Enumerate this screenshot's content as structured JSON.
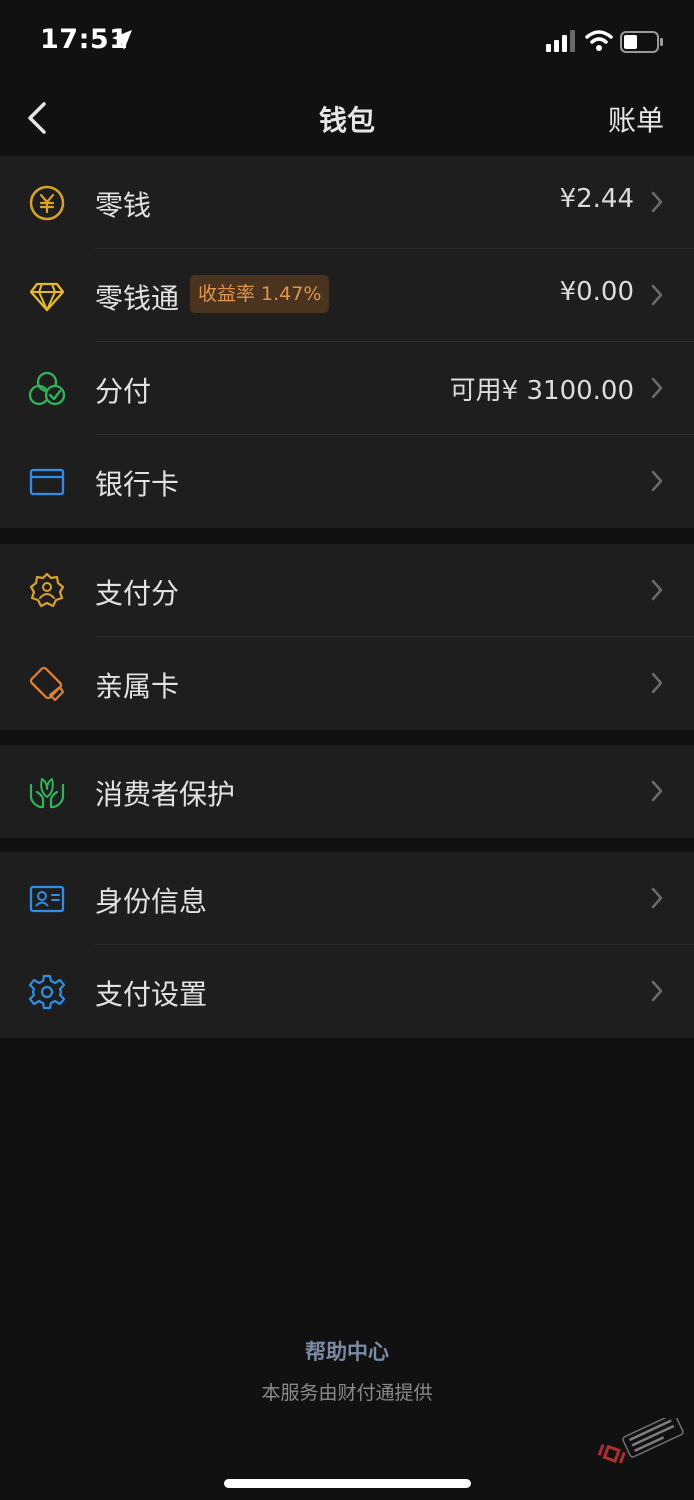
{
  "status_bar": {
    "time": "17:51",
    "icons": [
      "location-arrow-icon",
      "cellular-signal-icon",
      "wifi-icon",
      "battery-icon"
    ]
  },
  "nav": {
    "title": "钱包",
    "right_action": "账单",
    "back_icon": "chevron-left-icon"
  },
  "groups": [
    {
      "items": [
        {
          "icon": "yuan-coin-icon",
          "color": "#d9a32a",
          "label": "零钱",
          "value": "¥2.44"
        },
        {
          "icon": "diamond-icon",
          "color": "#e7b82c",
          "label": "零钱通",
          "badge": "收益率 1.47%",
          "value": "¥0.00"
        },
        {
          "icon": "fenfu-circles-icon",
          "color": "#2fb45a",
          "label": "分付",
          "value": "可用¥ 3100.00"
        },
        {
          "icon": "bank-card-icon",
          "color": "#2f8ee8",
          "label": "银行卡",
          "value": ""
        }
      ]
    },
    {
      "items": [
        {
          "icon": "payment-score-badge-icon",
          "color": "#d9a32a",
          "label": "支付分",
          "value": ""
        },
        {
          "icon": "family-card-icon",
          "color": "#d97f3a",
          "label": "亲属卡",
          "value": ""
        }
      ]
    },
    {
      "items": [
        {
          "icon": "hands-leaf-icon",
          "color": "#2fb45a",
          "label": "消费者保护",
          "value": ""
        }
      ]
    },
    {
      "items": [
        {
          "icon": "id-card-icon",
          "color": "#2f8ee8",
          "label": "身份信息",
          "value": ""
        },
        {
          "icon": "gear-icon",
          "color": "#2f8ee8",
          "label": "支付设置",
          "value": ""
        }
      ]
    }
  ],
  "footer": {
    "help": "帮助中心",
    "provider": "本服务由财付通提供"
  },
  "watermark": {
    "text": "卡农社区"
  }
}
